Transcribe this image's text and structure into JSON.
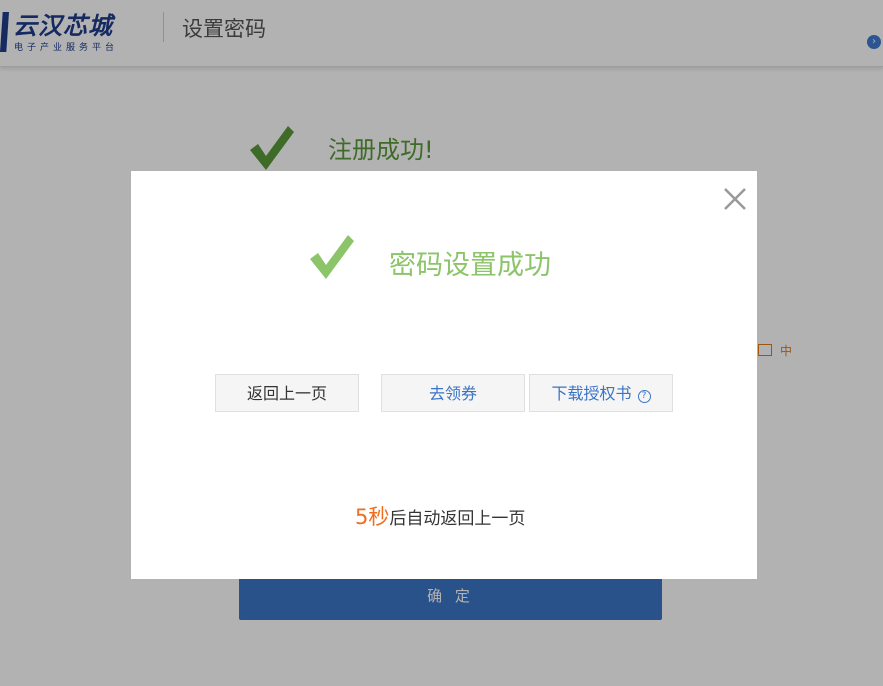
{
  "header": {
    "logo_title": "云汉芯城",
    "logo_subtitle": "电子产业服务平台",
    "page_title": "设置密码"
  },
  "background": {
    "success_text": "注册成功!",
    "box_label": "中",
    "confirm_label": "确 定"
  },
  "modal": {
    "title": "密码设置成功",
    "buttons": {
      "back": "返回上一页",
      "coupon": "去领券",
      "download": "下载授权书"
    },
    "countdown": {
      "seconds": "5秒",
      "suffix": "后自动返回上一页"
    }
  },
  "colors": {
    "brand": "#1d3d8c",
    "success_green": "#8cc46a",
    "link_blue": "#3b74c6",
    "countdown_orange": "#f26c1d"
  },
  "icons": [
    "check-icon",
    "close-icon",
    "help-icon",
    "chevron-right-icon"
  ]
}
